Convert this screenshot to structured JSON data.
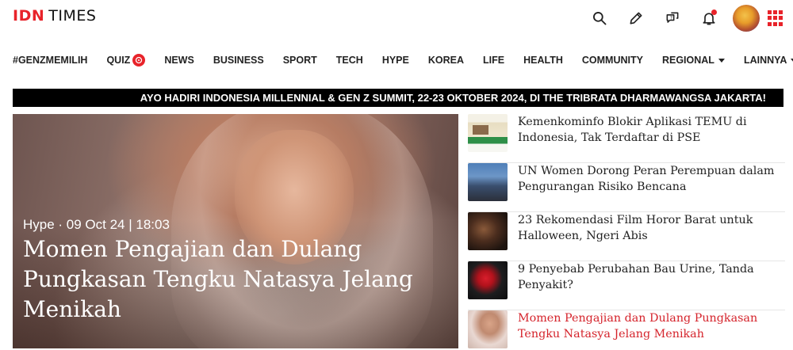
{
  "header": {
    "logo_brand": "IDN",
    "logo_suffix": "TIMES",
    "icons": [
      "search-icon",
      "pencil-icon",
      "quiz-chat-icon",
      "bell-icon",
      "avatar",
      "apps-grid-icon"
    ],
    "accent_color": "#e8232a"
  },
  "nav": {
    "items": [
      {
        "label": "#GENZMEMILIH"
      },
      {
        "label": "QUIZ"
      },
      {
        "label": "NEWS"
      },
      {
        "label": "BUSINESS"
      },
      {
        "label": "SPORT"
      },
      {
        "label": "TECH"
      },
      {
        "label": "HYPE"
      },
      {
        "label": "KOREA"
      },
      {
        "label": "LIFE"
      },
      {
        "label": "HEALTH"
      },
      {
        "label": "COMMUNITY"
      },
      {
        "label": "REGIONAL"
      },
      {
        "label": "LAINNYA"
      }
    ]
  },
  "banner": {
    "text": "AYO HADIRI INDONESIA MILLENNIAL & GEN Z SUMMIT, 22-23 OKTOBER 2024, DI THE TRIBRATA DHARMAWANGSA JAKARTA!"
  },
  "hero": {
    "meta": "Hype · 09 Oct 24 | 18:03",
    "title": "Momen Pengajian dan Dulang Pungkasan Tengku Natasya Jelang Menikah"
  },
  "side_list": [
    {
      "title": "Kemenkominfo Blokir Aplikasi TEMU di Indonesia, Tak Terdaftar di PSE"
    },
    {
      "title": "UN Women Dorong Peran Perempuan dalam Pengurangan Risiko Bencana"
    },
    {
      "title": "23 Rekomendasi Film Horor Barat untuk Halloween, Ngeri Abis"
    },
    {
      "title": "9 Penyebab Perubahan Bau Urine, Tanda Penyakit?"
    },
    {
      "title": "Momen Pengajian dan Dulang Pungkasan Tengku Natasya Jelang Menikah"
    }
  ]
}
